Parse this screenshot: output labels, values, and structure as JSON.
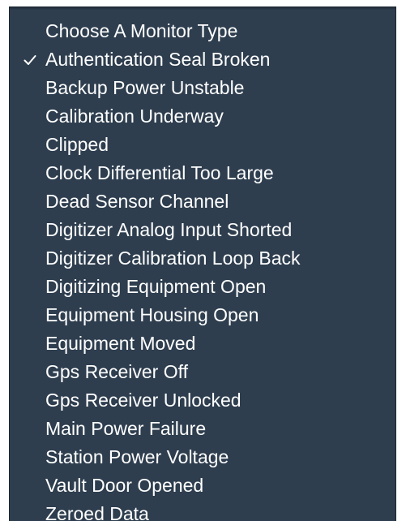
{
  "menu": {
    "items": [
      {
        "label": "Choose A Monitor Type",
        "checked": false,
        "header": true
      },
      {
        "label": "Authentication Seal Broken",
        "checked": true
      },
      {
        "label": "Backup Power Unstable",
        "checked": false
      },
      {
        "label": "Calibration Underway",
        "checked": false
      },
      {
        "label": "Clipped",
        "checked": false
      },
      {
        "label": "Clock Differential Too Large",
        "checked": false
      },
      {
        "label": "Dead Sensor Channel",
        "checked": false
      },
      {
        "label": "Digitizer Analog Input Shorted",
        "checked": false
      },
      {
        "label": "Digitizer Calibration Loop Back",
        "checked": false
      },
      {
        "label": "Digitizing Equipment Open",
        "checked": false
      },
      {
        "label": "Equipment Housing Open",
        "checked": false
      },
      {
        "label": "Equipment Moved",
        "checked": false
      },
      {
        "label": "Gps Receiver Off",
        "checked": false
      },
      {
        "label": "Gps Receiver Unlocked",
        "checked": false
      },
      {
        "label": "Main Power Failure",
        "checked": false
      },
      {
        "label": "Station Power Voltage",
        "checked": false
      },
      {
        "label": "Vault Door Opened",
        "checked": false
      },
      {
        "label": "Zeroed Data",
        "checked": false
      }
    ]
  },
  "colors": {
    "menu_background": "#2e3e4f",
    "text": "#ffffff"
  },
  "icons": {
    "checkmark": "checkmark-icon"
  }
}
